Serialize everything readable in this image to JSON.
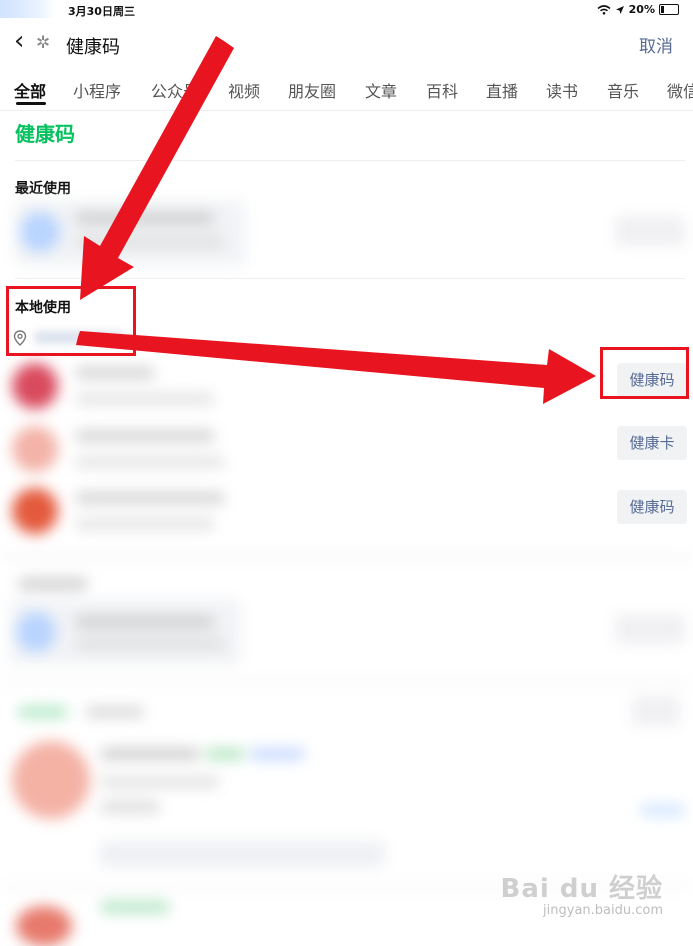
{
  "status_bar": {
    "date": "3月30日周三",
    "battery": "20%"
  },
  "header": {
    "back_symbol": "‹",
    "title": "健康码",
    "cancel": "取消"
  },
  "tabs": [
    "全部",
    "小程序",
    "公众号",
    "视频",
    "朋友圈",
    "文章",
    "百科",
    "直播",
    "读书",
    "音乐",
    "微信"
  ],
  "search_keyword": "健康码",
  "sections": {
    "recent": "最近使用",
    "local": "本地使用"
  },
  "service_buttons": [
    "健康码",
    "健康卡",
    "健康码"
  ],
  "watermark": {
    "logo": "Bai du 经验",
    "url": "jingyan.baidu.com"
  },
  "colors": {
    "accent_green": "#07c160",
    "link_blue": "#576b95",
    "annotation_red": "#e8141f"
  }
}
